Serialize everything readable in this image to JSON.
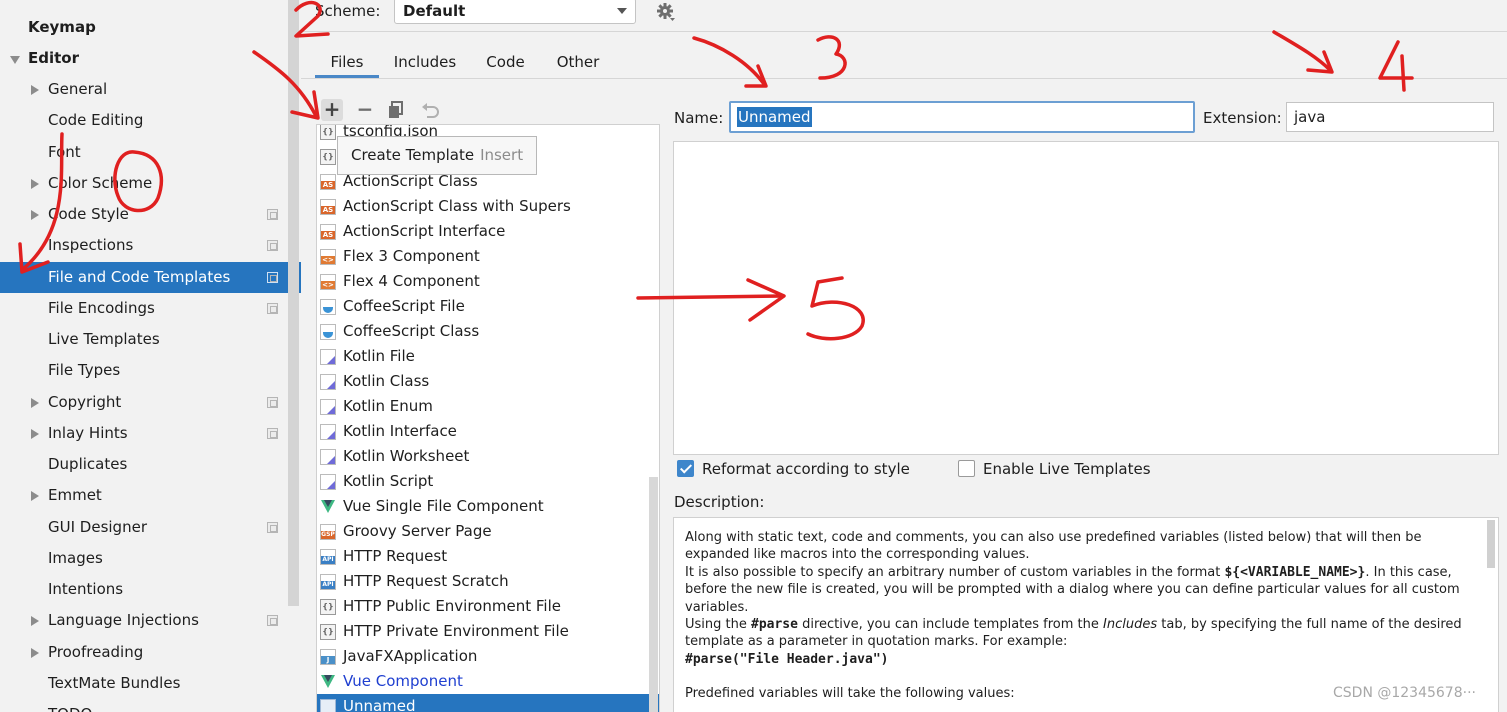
{
  "sidebar": {
    "items": [
      {
        "label": "Keymap"
      },
      {
        "label": "Editor"
      },
      {
        "label": "General"
      },
      {
        "label": "Code Editing"
      },
      {
        "label": "Font"
      },
      {
        "label": "Color Scheme"
      },
      {
        "label": "Code Style"
      },
      {
        "label": "Inspections"
      },
      {
        "label": "File and Code Templates"
      },
      {
        "label": "File Encodings"
      },
      {
        "label": "Live Templates"
      },
      {
        "label": "File Types"
      },
      {
        "label": "Copyright"
      },
      {
        "label": "Inlay Hints"
      },
      {
        "label": "Duplicates"
      },
      {
        "label": "Emmet"
      },
      {
        "label": "GUI Designer"
      },
      {
        "label": "Images"
      },
      {
        "label": "Intentions"
      },
      {
        "label": "Language Injections"
      },
      {
        "label": "Proofreading"
      },
      {
        "label": "TextMate Bundles"
      },
      {
        "label": "TODO"
      }
    ]
  },
  "scheme": {
    "label": "Scheme:",
    "value": "Default",
    "gear_icon": "gear-icon"
  },
  "tabs": [
    {
      "label": "Files",
      "active": true
    },
    {
      "label": "Includes"
    },
    {
      "label": "Code"
    },
    {
      "label": "Other"
    }
  ],
  "toolbar": {
    "add": "+",
    "remove": "−",
    "copy_icon": "copy-icon",
    "reset_icon": "reset-icon"
  },
  "tooltip": {
    "label": "Create Template",
    "shortcut": "Insert"
  },
  "templates": [
    {
      "label": "tsconfig.json",
      "icon": "json-file-icon"
    },
    {
      "label": "",
      "icon": "json-file-icon"
    },
    {
      "label": "ActionScript Class",
      "icon": "actionscript-icon"
    },
    {
      "label": "ActionScript Class with Supers",
      "icon": "actionscript-icon"
    },
    {
      "label": "ActionScript Interface",
      "icon": "actionscript-icon"
    },
    {
      "label": "Flex 3 Component",
      "icon": "flex-icon"
    },
    {
      "label": "Flex 4 Component",
      "icon": "flex-icon"
    },
    {
      "label": "CoffeeScript File",
      "icon": "coffeescript-icon"
    },
    {
      "label": "CoffeeScript Class",
      "icon": "coffeescript-icon"
    },
    {
      "label": "Kotlin File",
      "icon": "kotlin-icon"
    },
    {
      "label": "Kotlin Class",
      "icon": "kotlin-icon"
    },
    {
      "label": "Kotlin Enum",
      "icon": "kotlin-icon"
    },
    {
      "label": "Kotlin Interface",
      "icon": "kotlin-icon"
    },
    {
      "label": "Kotlin Worksheet",
      "icon": "kotlin-icon"
    },
    {
      "label": "Kotlin Script",
      "icon": "kotlin-icon"
    },
    {
      "label": "Vue Single File Component",
      "icon": "vue-icon"
    },
    {
      "label": "Groovy Server Page",
      "icon": "gsp-icon"
    },
    {
      "label": "HTTP Request",
      "icon": "api-icon"
    },
    {
      "label": "HTTP Request Scratch",
      "icon": "api-icon"
    },
    {
      "label": "HTTP Public Environment File",
      "icon": "json-file-icon"
    },
    {
      "label": "HTTP Private Environment File",
      "icon": "json-file-icon"
    },
    {
      "label": "JavaFXApplication",
      "icon": "java-file-icon"
    },
    {
      "label": "Vue Component",
      "icon": "vue-icon"
    },
    {
      "label": "Unnamed",
      "icon": "template-icon"
    }
  ],
  "form": {
    "name_label": "Name:",
    "name_value": "Unnamed",
    "extension_label": "Extension:",
    "extension_value": "java",
    "reformat_label": "Reformat according to style",
    "reformat_checked": true,
    "live_templates_label": "Enable Live Templates",
    "live_templates_checked": false,
    "description_label": "Description:"
  },
  "description": {
    "p1": "Along with static text, code and comments, you can also use predefined variables (listed below) that will then be expanded like macros into the corresponding values.",
    "p2a": "It is also possible to specify an arbitrary number of custom variables in the format ",
    "p2code": "${<VARIABLE_NAME>}",
    "p2b": ". In this case, before the new file is created, you will be prompted with a dialog where you can define particular values for all custom variables.",
    "p3a": "Using the ",
    "p3code": "#parse",
    "p3b": " directive, you can include templates from the ",
    "p3em": "Includes",
    "p3c": " tab, by specifying the full name of the desired template as a parameter in quotation marks. For example:",
    "p4code": "#parse(\"File Header.java\")",
    "p5": "Predefined variables will take the following values:"
  },
  "watermark": "CSDN @12345678···",
  "annotations": {
    "n1": "1",
    "n2": "2",
    "n3": "3",
    "n4": "4",
    "n5": "5",
    "color": "#e02020"
  }
}
